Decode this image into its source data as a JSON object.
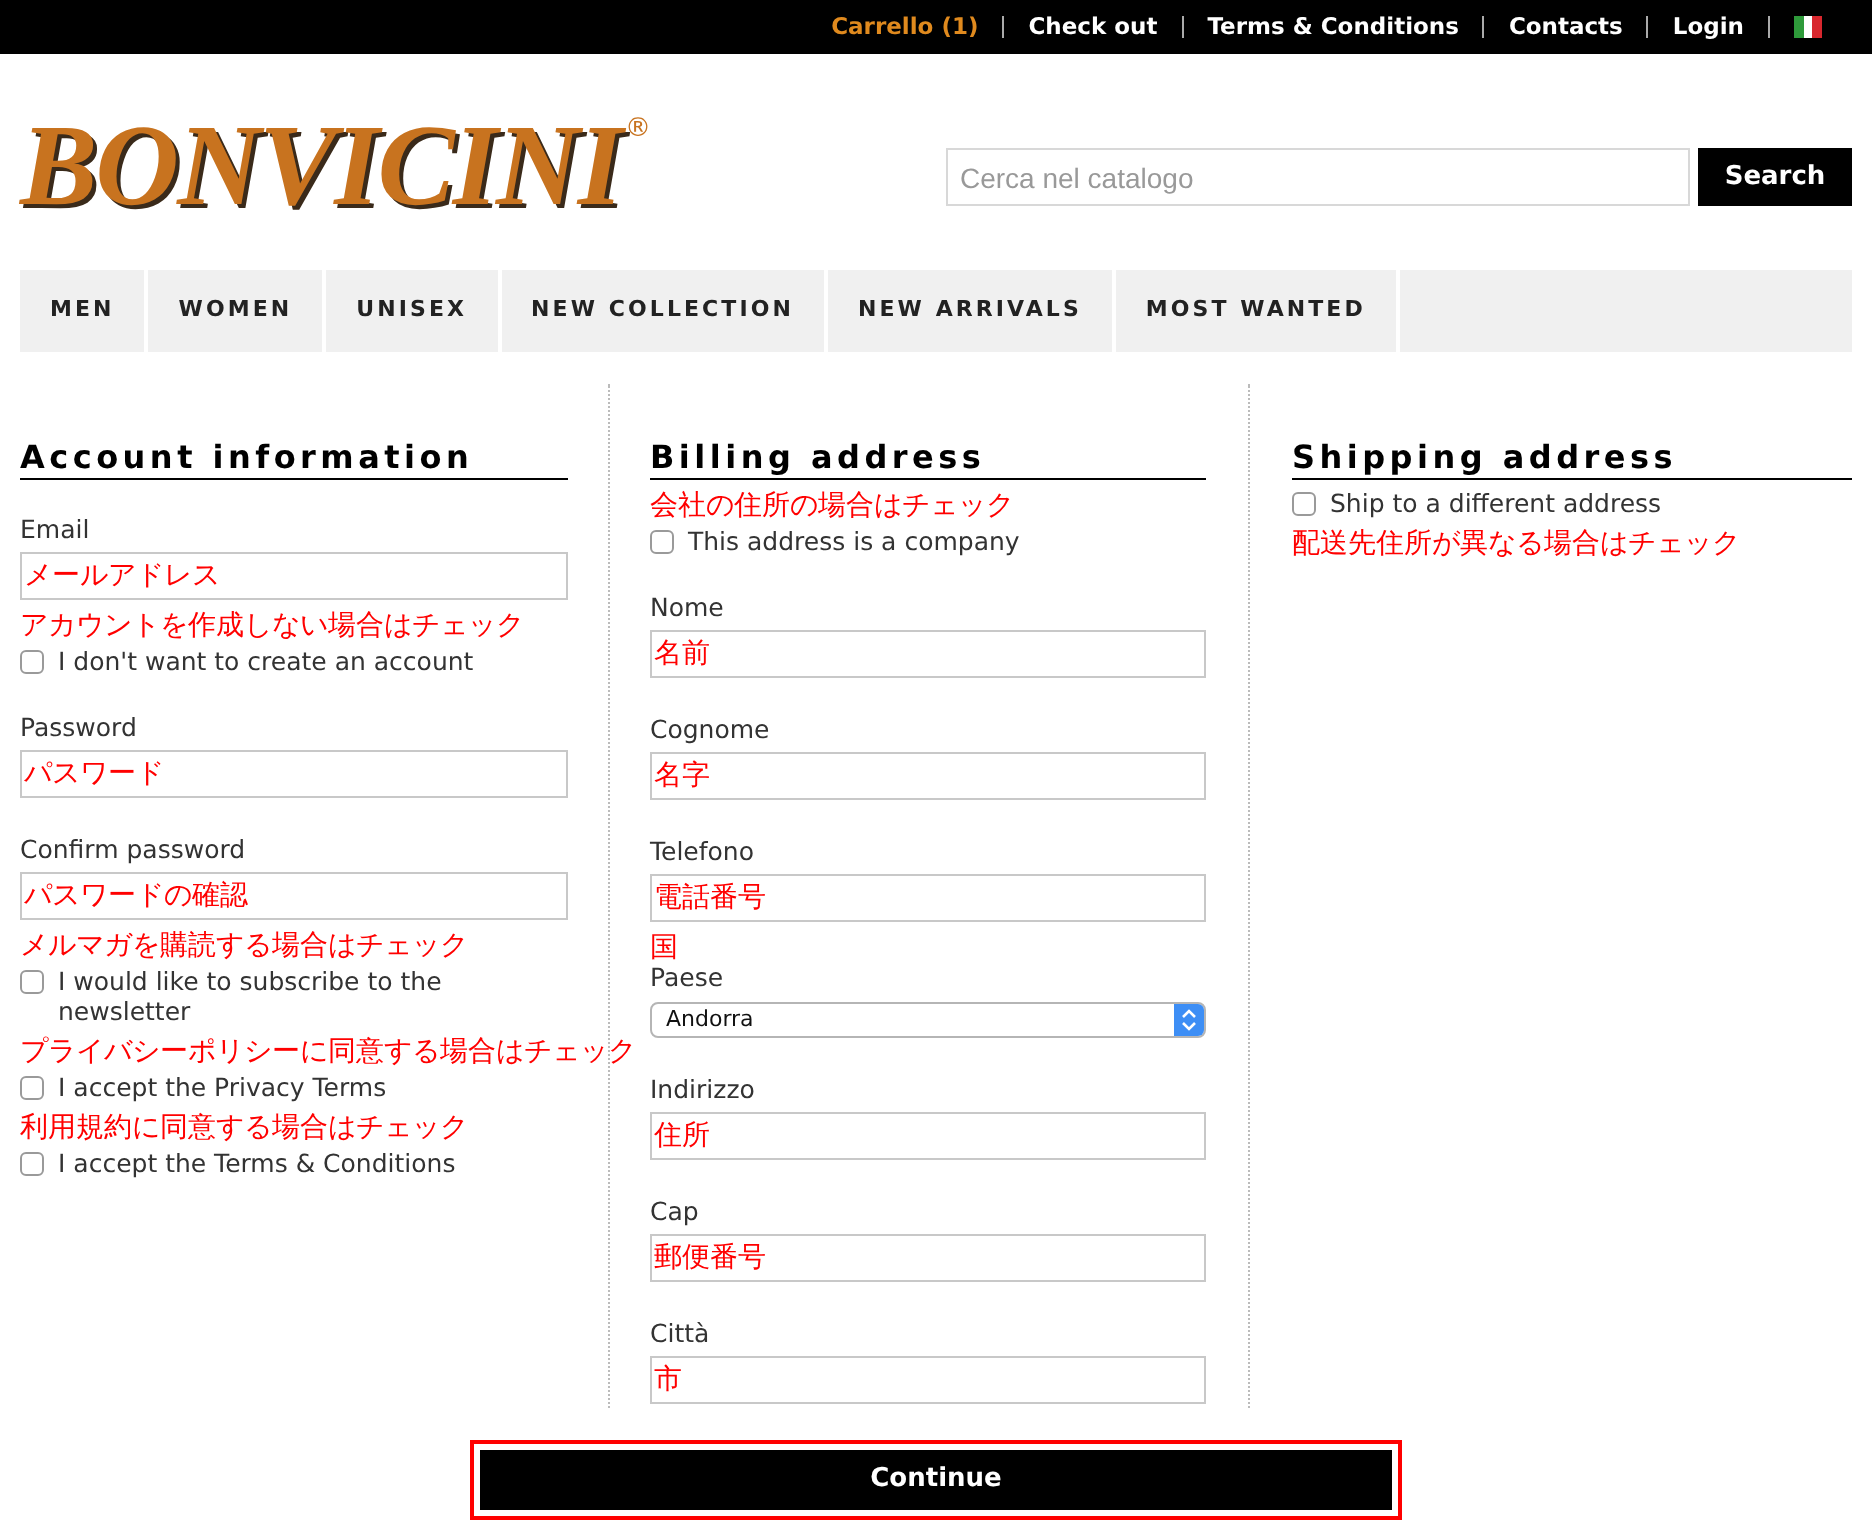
{
  "top_bar": {
    "links": [
      {
        "label": "Carrello (1)",
        "highlighted": true
      },
      {
        "label": "Check out",
        "highlighted": false
      },
      {
        "label": "Terms & Conditions",
        "highlighted": false
      },
      {
        "label": "Contacts",
        "highlighted": false
      },
      {
        "label": "Login",
        "highlighted": false
      }
    ]
  },
  "logo": {
    "text": "BONVICINI",
    "mark": "®"
  },
  "search": {
    "placeholder": "Cerca nel catalogo",
    "button": "Search"
  },
  "nav": [
    "MEN",
    "WOMEN",
    "UNISEX",
    "NEW COLLECTION",
    "NEW ARRIVALS",
    "MOST WANTED"
  ],
  "columns": [
    {
      "title": "Account information",
      "items": [
        {
          "kind": "field",
          "label": "Email",
          "value": "メールアドレス"
        },
        {
          "kind": "note",
          "text": "アカウントを作成しない場合はチェック"
        },
        {
          "kind": "checkbox",
          "label": "I don't want to create an account",
          "checked": false
        },
        {
          "kind": "field",
          "label": "Password",
          "value": "パスワード"
        },
        {
          "kind": "field",
          "label": "Confirm password",
          "value": "パスワードの確認"
        },
        {
          "kind": "note",
          "text": "メルマガを購読する場合はチェック"
        },
        {
          "kind": "checkbox",
          "label": "I would like to subscribe to the newsletter",
          "checked": false
        },
        {
          "kind": "note",
          "text": "プライバシーポリシーに同意する場合はチェック"
        },
        {
          "kind": "checkbox",
          "label": "I accept the Privacy Terms",
          "checked": false
        },
        {
          "kind": "note",
          "text": "利用規約に同意する場合はチェック"
        },
        {
          "kind": "checkbox",
          "label": "I accept the Terms & Conditions",
          "checked": false
        }
      ]
    },
    {
      "title": "Billing address",
      "items": [
        {
          "kind": "note",
          "text": "会社の住所の場合はチェック"
        },
        {
          "kind": "checkbox",
          "label": "This address is a company",
          "checked": false
        },
        {
          "kind": "field",
          "label": "Nome",
          "value": "名前"
        },
        {
          "kind": "field",
          "label": "Cognome",
          "value": "名字"
        },
        {
          "kind": "field",
          "label": "Telefono",
          "value": "電話番号"
        },
        {
          "kind": "note",
          "text": "国"
        },
        {
          "kind": "select",
          "label": "Paese",
          "value": "Andorra"
        },
        {
          "kind": "field",
          "label": "Indirizzo",
          "value": "住所"
        },
        {
          "kind": "field",
          "label": "Cap",
          "value": "郵便番号"
        },
        {
          "kind": "field",
          "label": "Città",
          "value": "市"
        }
      ]
    },
    {
      "title": "Shipping address",
      "items": [
        {
          "kind": "checkbox",
          "label": "Ship to a different address",
          "checked": false
        },
        {
          "kind": "note",
          "text": "配送先住所が異なる場合はチェック"
        }
      ]
    }
  ],
  "continue": {
    "label": "Continue",
    "highlighted": true
  }
}
